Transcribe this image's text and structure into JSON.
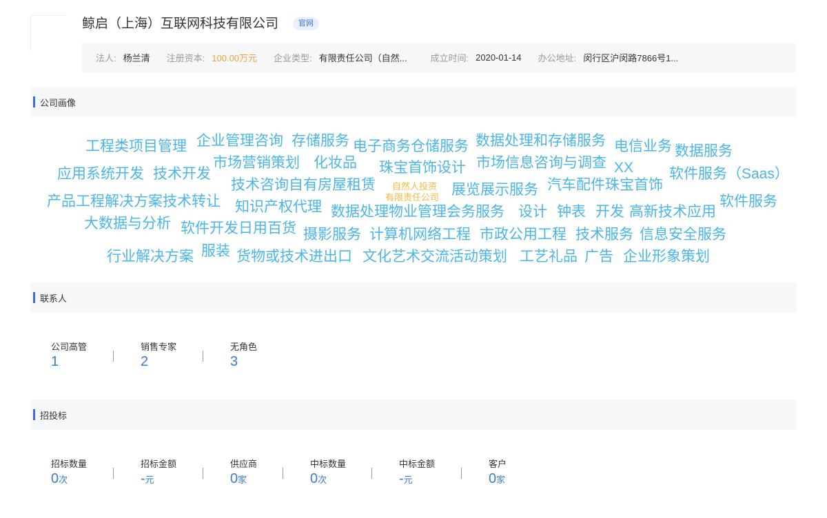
{
  "company": {
    "name": "鲸启（上海）互联网科技有限公司",
    "official_tag": "官网"
  },
  "info": {
    "legal_person_label": "法人:",
    "legal_person": "杨兰清",
    "capital_label": "注册资本:",
    "capital": "100.00万元",
    "type_label": "企业类型:",
    "type": "有限责任公司（自然...",
    "founded_label": "成立时间:",
    "founded": "2020-01-14",
    "address_label": "办公地址:",
    "address": "闵行区沪闵路7866号1..."
  },
  "sections": {
    "portrait": "公司画像",
    "contacts": "联系人",
    "bidding": "招投标"
  },
  "word_cloud": [
    "工程类项目管理",
    "企业管理咨询",
    "存储服务",
    "电子商务仓储服务",
    "数据处理和存储服务",
    "电信业务",
    "数据服务",
    "应用系统开发",
    "技术开发",
    "市场营销策划",
    "化妆品",
    "珠宝首饰设计",
    "市场信息咨询与调查",
    "XX",
    "软件服务（Saas）",
    "技术咨询自有房屋租赁",
    "自然人投资",
    "有限责任公司",
    "展览展示服务",
    "汽车配件珠宝首饰",
    "产品工程解决方案技术转让",
    "知识产权代理",
    "数据处理物业管理会务服务",
    "设计",
    "钟表",
    "开发",
    "高新技术应用",
    "软件服务",
    "大数据与分析",
    "软件开发日用百货",
    "摄影服务",
    "计算机网络工程",
    "市政公用工程",
    "技术服务",
    "信息安全服务",
    "行业解决方案",
    "服装",
    "货物或技术进出口",
    "文化艺术交流活动策划",
    "工艺礼品",
    "广告",
    "企业形象策划"
  ],
  "contacts": [
    {
      "label": "公司高管",
      "value": "1"
    },
    {
      "label": "销售专家",
      "value": "2"
    },
    {
      "label": "无角色",
      "value": "3"
    }
  ],
  "bidding": [
    {
      "label": "招标数量",
      "value": "0",
      "unit": "次"
    },
    {
      "label": "招标金额",
      "value": "-",
      "unit": "元"
    },
    {
      "label": "供应商",
      "value": "0",
      "unit": "家"
    },
    {
      "label": "中标数量",
      "value": "0",
      "unit": "次"
    },
    {
      "label": "中标金额",
      "value": "-",
      "unit": "元"
    },
    {
      "label": "客户",
      "value": "0",
      "unit": "家"
    }
  ],
  "colors": {
    "accent": "#3a6fd8",
    "cloud_blue": "#4ab6e8",
    "cloud_orange": "#f4b942",
    "capital_orange": "#f2a13a"
  }
}
